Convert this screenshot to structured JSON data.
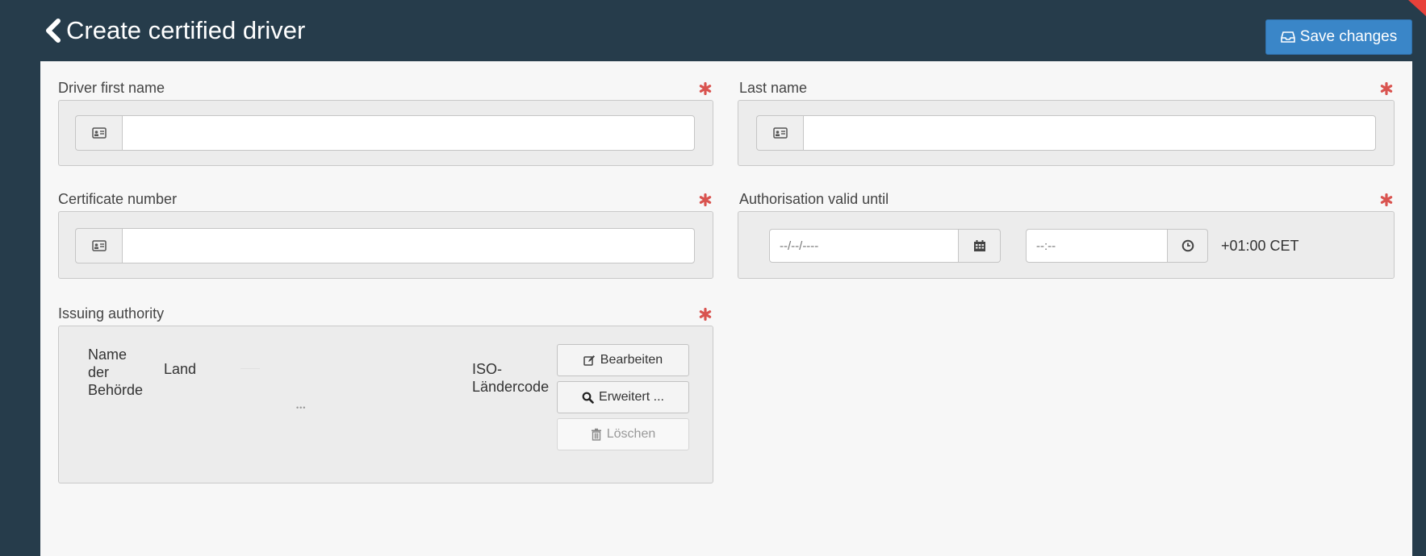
{
  "header": {
    "title": "Create certified driver",
    "save_label": "Save changes",
    "accent_color": "#3a86c8",
    "background_color": "#263c4b"
  },
  "form": {
    "first_name": {
      "label": "Driver first name",
      "value": ""
    },
    "last_name": {
      "label": "Last name",
      "value": ""
    },
    "certificate_number": {
      "label": "Certificate number",
      "value": ""
    },
    "authorisation_valid_until": {
      "label": "Authorisation valid until",
      "date_placeholder": "--/--/----",
      "time_placeholder": "--:--",
      "timezone": "+01:00 CET"
    },
    "issuing_authority": {
      "label": "Issuing authority",
      "columns": {
        "name": "Name der Behörde",
        "country": "Land",
        "iso": "ISO-Ländercode"
      },
      "ellipsis": "•••",
      "buttons": {
        "edit": "Bearbeiten",
        "advanced": "Erweitert ...",
        "delete": "Löschen"
      }
    },
    "required_color": "#d9534f"
  },
  "icons": {
    "back": "chevron-left-icon",
    "save": "inbox-icon",
    "id_card": "id-card-icon",
    "calendar": "calendar-icon",
    "clock": "clock-icon",
    "edit": "pencil-square-icon",
    "search": "search-icon",
    "trash": "trash-icon",
    "required": "asterisk-icon"
  }
}
